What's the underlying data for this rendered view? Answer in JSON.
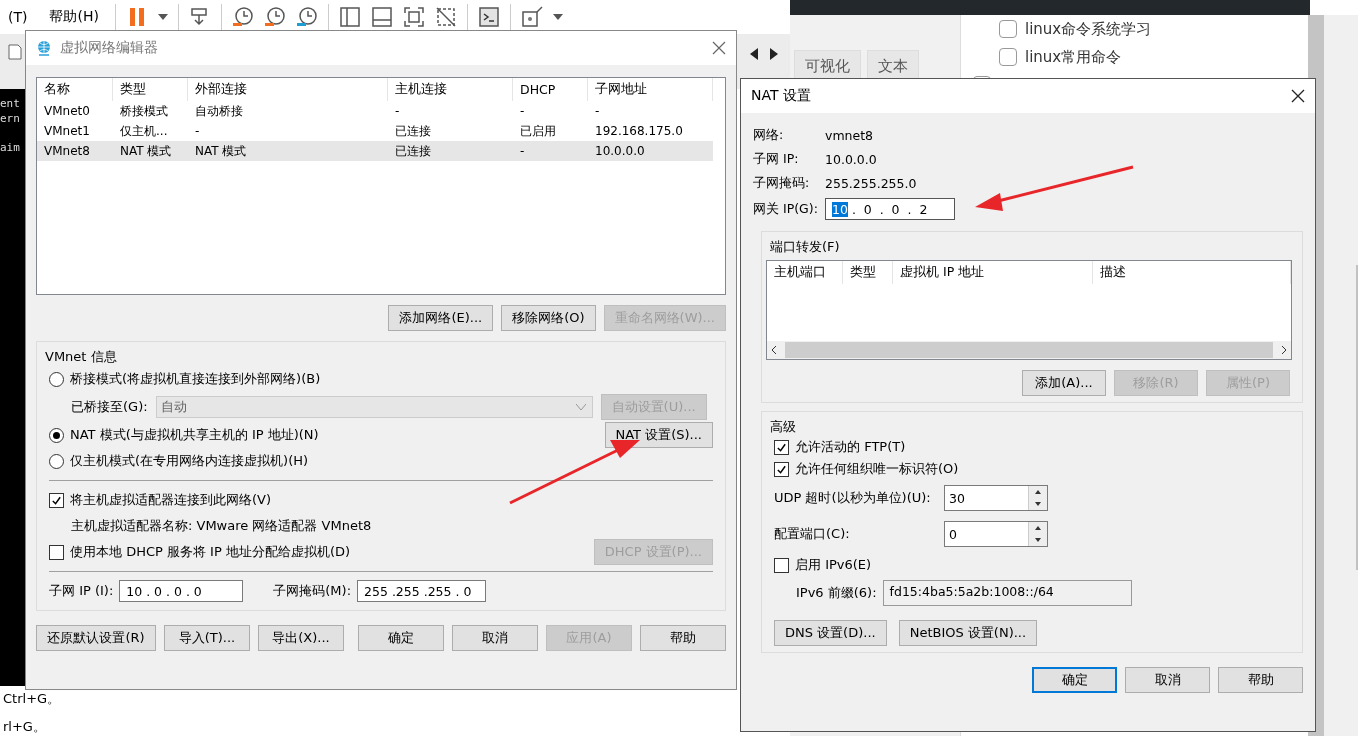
{
  "vmware_app": {
    "menu": [
      {
        "label": "(T)"
      },
      {
        "label": "帮助(H)"
      }
    ],
    "terminal_lines": [
      "ent",
      "ern",
      "aim"
    ],
    "status_lines": [
      "Ctrl+G。",
      "rl+G。"
    ]
  },
  "blog_editor": {
    "tabs": [
      {
        "label": "可视化"
      },
      {
        "label": "文本"
      }
    ],
    "categories": [
      {
        "label": "linux命令系统学习",
        "checked": false
      },
      {
        "label": "linux常用命令",
        "checked": false
      },
      {
        "checked": false
      }
    ]
  },
  "virtual_network_editor": {
    "title": "虚拟网络编辑器",
    "table": {
      "columns": [
        "名称",
        "类型",
        "外部连接",
        "主机连接",
        "DHCP",
        "子网地址"
      ],
      "rows": [
        {
          "cells": [
            "VMnet0",
            "桥接模式",
            "自动桥接",
            "-",
            "-",
            "-"
          ],
          "selected": false
        },
        {
          "cells": [
            "VMnet1",
            "仅主机...",
            "-",
            "已连接",
            "已启用",
            "192.168.175.0"
          ],
          "selected": false
        },
        {
          "cells": [
            "VMnet8",
            "NAT 模式",
            "NAT 模式",
            "已连接",
            "-",
            "10.0.0.0"
          ],
          "selected": true
        }
      ]
    },
    "table_buttons": [
      {
        "label": "添加网络(E)...",
        "disabled": false
      },
      {
        "label": "移除网络(O)",
        "disabled": false
      },
      {
        "label": "重命名网络(W)...",
        "disabled": true
      }
    ],
    "group_title": "VMnet 信息",
    "modes": [
      {
        "label": "桥接模式(将虚拟机直接连接到外部网络)(B)",
        "selected": false
      },
      {
        "label": "NAT 模式(与虚拟机共享主机的 IP 地址)(N)",
        "selected": true
      },
      {
        "label": "仅主机模式(在专用网络内连接虚拟机)(H)",
        "selected": false
      }
    ],
    "bridged_to": {
      "label": "已桥接至(G):",
      "value": "自动",
      "disabled": true,
      "button": {
        "label": "自动设置(U)...",
        "disabled": true
      }
    },
    "nat_button": {
      "label": "NAT 设置(S)...",
      "disabled": false
    },
    "connect_adapter": {
      "label": "将主机虚拟适配器连接到此网络(V)",
      "checked": true
    },
    "adapter_name": "主机虚拟适配器名称: VMware 网络适配器 VMnet8",
    "use_dhcp": {
      "label": "使用本地 DHCP 服务将 IP 地址分配给虚拟机(D)",
      "checked": false
    },
    "dhcp_button": {
      "label": "DHCP 设置(P)...",
      "disabled": true
    },
    "subnet_ip": {
      "label": "子网 IP (I):",
      "value": "10 . 0 . 0 . 0"
    },
    "subnet_mask": {
      "label": "子网掩码(M):",
      "value": "255 .255 .255 . 0"
    },
    "footer_buttons": [
      {
        "label": "还原默认设置(R)",
        "disabled": false
      },
      {
        "label": "导入(T)...",
        "disabled": false
      },
      {
        "label": "导出(X)...",
        "disabled": false
      },
      {
        "label": "确定",
        "disabled": false
      },
      {
        "label": "取消",
        "disabled": false
      },
      {
        "label": "应用(A)",
        "disabled": true
      },
      {
        "label": "帮助",
        "disabled": false
      }
    ]
  },
  "nat_settings": {
    "title": "NAT 设置",
    "info": [
      {
        "label": "网络:",
        "value": "vmnet8"
      },
      {
        "label": "子网 IP:",
        "value": "10.0.0.0"
      },
      {
        "label": "子网掩码:",
        "value": "255.255.255.0"
      }
    ],
    "gateway": {
      "label": "网关 IP(G):",
      "segments": [
        {
          "text": "10",
          "selected": true
        },
        {
          "text": " .  0  .  0  .  2",
          "selected": false
        }
      ]
    },
    "port_forwarding": {
      "title": "端口转发(F)",
      "columns": [
        "主机端口",
        "类型",
        "虚拟机 IP 地址",
        "描述"
      ],
      "buttons": [
        {
          "label": "添加(A)...",
          "disabled": false
        },
        {
          "label": "移除(R)",
          "disabled": true
        },
        {
          "label": "属性(P)",
          "disabled": true
        }
      ]
    },
    "advanced": {
      "title": "高级",
      "options": [
        {
          "label": "允许活动的 FTP(T)",
          "checked": true
        },
        {
          "label": "允许任何组织唯一标识符(O)",
          "checked": true
        }
      ],
      "spinners": [
        {
          "label": "UDP 超时(以秒为单位)(U):",
          "value": "30"
        },
        {
          "label": "配置端口(C):",
          "value": "0"
        }
      ],
      "ipv6": {
        "label": "启用 IPv6(E)",
        "checked": false
      },
      "ipv6_prefix": {
        "label": "IPv6 前缀(6):",
        "value": "fd15:4ba5:5a2b:1008::/64"
      },
      "buttons": [
        {
          "label": "DNS 设置(D)...",
          "disabled": false
        },
        {
          "label": "NetBIOS 设置(N)...",
          "disabled": false
        }
      ]
    },
    "footer_buttons": [
      {
        "label": "确定",
        "disabled": false,
        "default": true
      },
      {
        "label": "取消",
        "disabled": false,
        "default": false
      },
      {
        "label": "帮助",
        "disabled": false,
        "default": false
      }
    ]
  }
}
